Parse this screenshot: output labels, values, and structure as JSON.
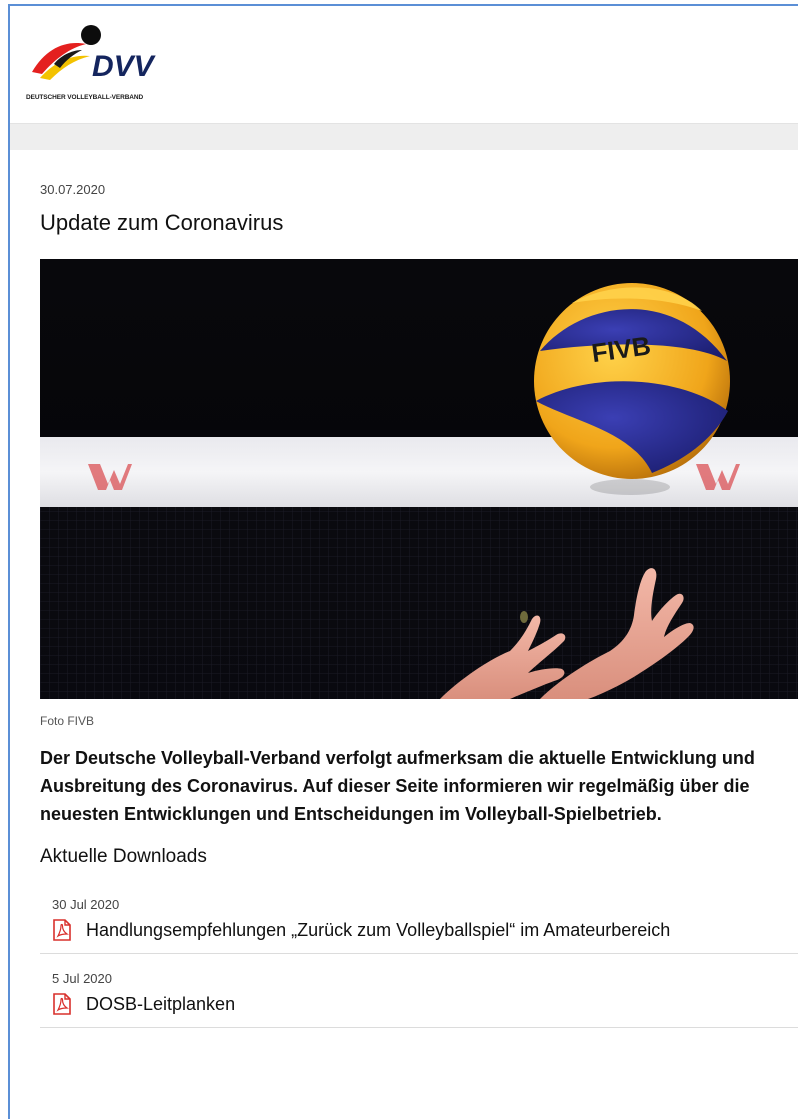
{
  "brand": {
    "logo_abbr": "DVV",
    "logo_fullname": "DEUTSCHER VOLLEYBALL-VERBAND"
  },
  "article": {
    "date": "30.07.2020",
    "title": "Update zum Coronavirus",
    "image_caption": "Foto FIVB",
    "image_ball_text": "FIVB",
    "lead": "Der Deutsche Volleyball-Verband verfolgt aufmerksam die aktuelle Entwicklung und Ausbreitung des Coronavirus. Auf dieser Seite informieren wir regelmäßig über die neuesten Entwicklungen und Entscheidungen im Volleyball-Spielbetrieb."
  },
  "downloads": {
    "heading": "Aktuelle Downloads",
    "items": [
      {
        "date": "30 Jul 2020",
        "label": "Handlungsempfehlungen „Zurück zum Volleyballspiel“ im Amateurbereich",
        "icon": "pdf-icon"
      },
      {
        "date": "5 Jul 2020",
        "label": "DOSB-Leitplanken",
        "icon": "pdf-icon"
      }
    ]
  },
  "colors": {
    "frame_border": "#5b8fd6",
    "pdf_red": "#d9302c",
    "logo_red": "#e4201f",
    "logo_yellow": "#f3c200",
    "logo_navy": "#14255e"
  }
}
